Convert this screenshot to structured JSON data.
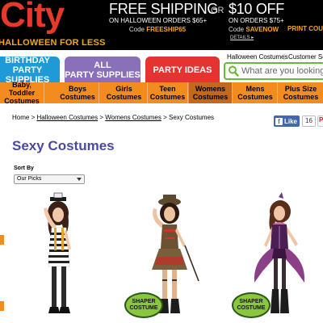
{
  "header": {
    "logo": "City",
    "tagline": "HALLOWEEN FOR LESS",
    "promo_free": {
      "headline": "FREE SHIPPING",
      "subtext": "ON HALLOWEEN ORDERS $65+",
      "code_label": "Code",
      "code": "FREESHIP65"
    },
    "promo_or": "OR",
    "promo_off": {
      "headline": "$10 OFF",
      "subtext": "ON ORDERS $75+",
      "code_label": "Code",
      "code": "SAVENOW"
    },
    "print_coupon": "PRINT COUP",
    "details": "DETAILS ▸",
    "links": [
      "Halloween Costumes",
      "Customer Se"
    ]
  },
  "tabs": [
    {
      "line1": "BIRTHDAY",
      "line2": "PARTY SUPPLIES"
    },
    {
      "line1": "ALL",
      "line2": "PARTY SUPPLIES"
    },
    {
      "line1": "PARTY IDEAS",
      "line2": ""
    }
  ],
  "search": {
    "placeholder": "What are you looking"
  },
  "subnav": [
    {
      "line1": "Baby, Toddler",
      "line2": "Costumes"
    },
    {
      "line1": "Boys",
      "line2": "Costumes"
    },
    {
      "line1": "Girls",
      "line2": "Costumes"
    },
    {
      "line1": "Teen",
      "line2": "Costumes"
    },
    {
      "line1": "Womens",
      "line2": "Costumes"
    },
    {
      "line1": "Mens",
      "line2": "Costumes"
    },
    {
      "line1": "Plus Size",
      "line2": "Costumes"
    }
  ],
  "breadcrumb": {
    "items": [
      "Home",
      "Halloween Costumes",
      "Womens Costumes"
    ],
    "current": "Sexy Costumes",
    "separator": ">"
  },
  "social": {
    "like": "Like",
    "count": "16",
    "pin": "P"
  },
  "page_title": "Sexy Costumes",
  "sort": {
    "label": "Sort By",
    "selected": "Our Picks"
  },
  "products": [
    {
      "badge": null
    },
    {
      "badge": "SHAPER COSTUME"
    },
    {
      "badge": "SHAPER COSTUME"
    }
  ],
  "colors": {
    "logo_red": "#e5392a",
    "tagline_orange": "#f3a81b",
    "tab_blue": "#1e9ad6",
    "tab_purple": "#8a6fb9",
    "tab_red": "#e3342f",
    "subnav_orange": "#f28c1e",
    "subnav_active": "#c6681b",
    "title_purple": "#4a4aa0",
    "badge_green": "#8cc63e"
  }
}
